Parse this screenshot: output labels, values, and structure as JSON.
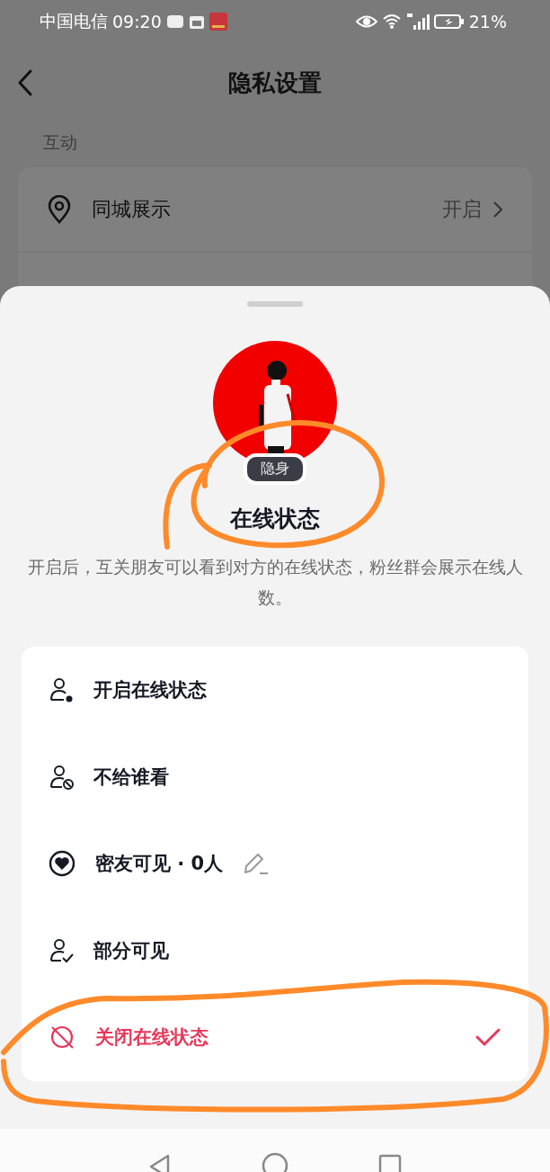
{
  "status_bar": {
    "carrier": "中国电信",
    "time": "09:20",
    "battery": "21%"
  },
  "header": {
    "title": "隐私设置"
  },
  "section": {
    "label": "互动"
  },
  "settings": [
    {
      "label": "同城展示",
      "value": "开启"
    }
  ],
  "sheet": {
    "badge": "隐身",
    "title": "在线状态",
    "description": "开启后，互关朋友可以看到对方的在线状态，粉丝群会展示在线人数。",
    "options": [
      {
        "kind": "online",
        "label": "开启在线状态",
        "editable": false,
        "selected": false
      },
      {
        "kind": "blocked",
        "label": "不给谁看",
        "editable": false,
        "selected": false
      },
      {
        "kind": "friends",
        "label": "密友可见 · 0人",
        "editable": true,
        "selected": false
      },
      {
        "kind": "partial",
        "label": "部分可见",
        "editable": false,
        "selected": false
      },
      {
        "kind": "offline",
        "label": "关闭在线状态",
        "editable": false,
        "selected": true
      }
    ]
  }
}
